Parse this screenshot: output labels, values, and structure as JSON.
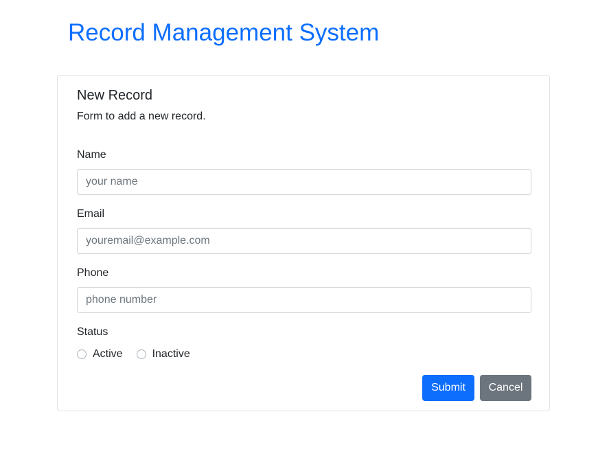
{
  "header": {
    "title": "Record Management System"
  },
  "form": {
    "title": "New Record",
    "description": "Form to add a new record.",
    "name": {
      "label": "Name",
      "placeholder": "your name",
      "value": ""
    },
    "email": {
      "label": "Email",
      "placeholder": "youremail@example.com",
      "value": ""
    },
    "phone": {
      "label": "Phone",
      "placeholder": "phone number",
      "value": ""
    },
    "status": {
      "label": "Status",
      "options": [
        "Active",
        "Inactive"
      ],
      "selected": null
    },
    "submit_label": "Submit",
    "cancel_label": "Cancel"
  },
  "colors": {
    "accent": "#0d6efd",
    "secondary": "#6c757d",
    "border": "#dee2e6"
  }
}
